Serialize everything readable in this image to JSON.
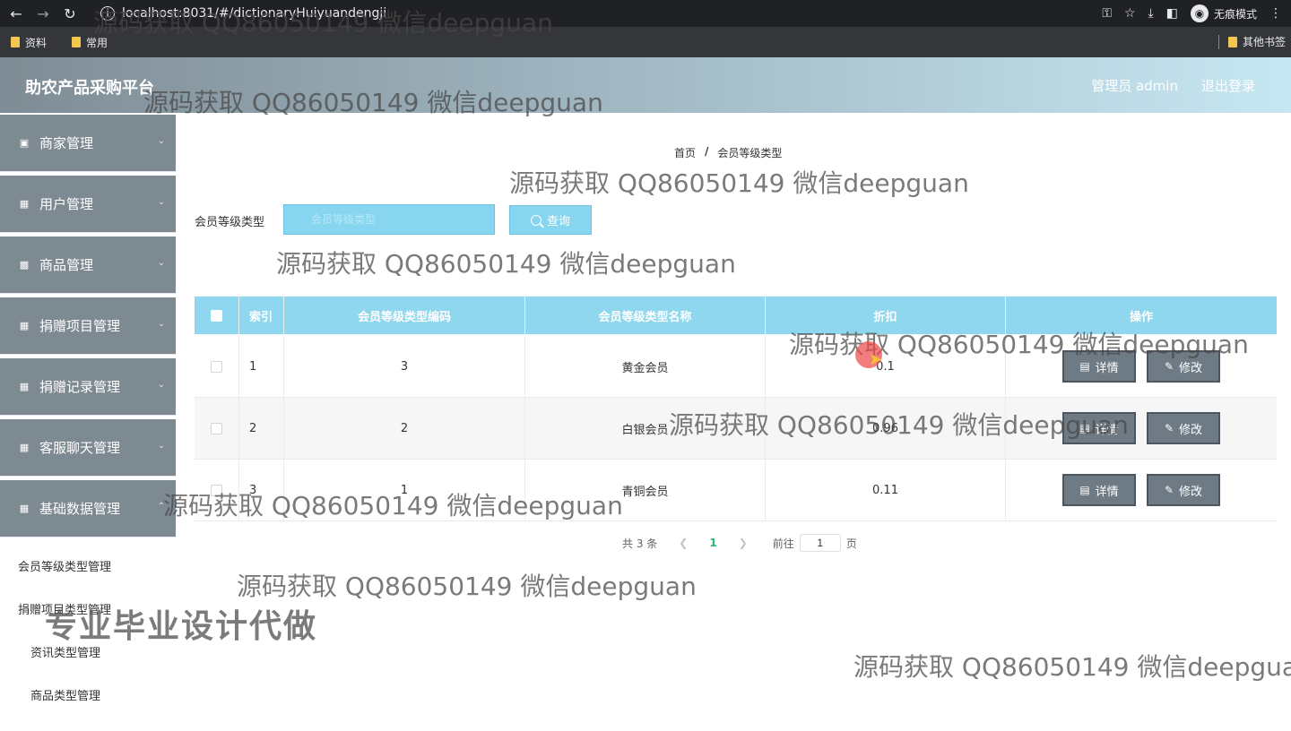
{
  "browser": {
    "url": "localhost:8031/#/dictionaryHuiyuandengji",
    "incognito_label": "无痕模式",
    "bookmarks": [
      "资料",
      "常用"
    ],
    "other_bookmarks": "其他书签"
  },
  "header": {
    "title": "助农产品采购平台",
    "user": "管理员 admin",
    "logout": "退出登录"
  },
  "sidebar": {
    "menus": [
      "商家管理",
      "用户管理",
      "商品管理",
      "捐赠项目管理",
      "捐赠记录管理",
      "客服聊天管理",
      "基础数据管理"
    ],
    "submenus": [
      "会员等级类型管理",
      "捐赠项目类型管理",
      "资讯类型管理",
      "商品类型管理"
    ]
  },
  "breadcrumb": {
    "home": "首页",
    "sep": "/",
    "current": "会员等级类型"
  },
  "search": {
    "label": "会员等级类型",
    "placeholder": "会员等级类型",
    "button": "查询"
  },
  "table": {
    "headers": [
      "索引",
      "会员等级类型编码",
      "会员等级类型名称",
      "折扣",
      "操作"
    ],
    "rows": [
      {
        "index": "1",
        "code": "3",
        "name": "黄金会员",
        "discount": "0.1"
      },
      {
        "index": "2",
        "code": "2",
        "name": "白银会员",
        "discount": "0.96"
      },
      {
        "index": "3",
        "code": "1",
        "name": "青铜会员",
        "discount": "0.11"
      }
    ],
    "detail_label": "详情",
    "edit_label": "修改"
  },
  "pagination": {
    "total": "共 3 条",
    "current": "1",
    "goto": "前往",
    "goto_value": "1",
    "page_unit": "页"
  },
  "overlay": {
    "watermark": "源码获取 QQ86050149 微信deepguan",
    "promo": "专业毕业设计代做"
  }
}
